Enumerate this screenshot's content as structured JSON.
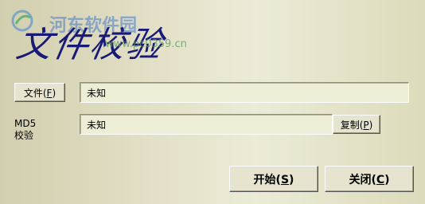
{
  "title_art": "文件校验",
  "watermark": {
    "site_name": "河东软件园",
    "url": "www.pc0359.cn"
  },
  "file_button": {
    "label_prefix": "文件(",
    "hotkey": "F",
    "label_suffix": ")"
  },
  "file_field": {
    "value": "未知"
  },
  "md5": {
    "label_line1": "MD5",
    "label_line2": "校验",
    "value": "未知"
  },
  "copy_button": {
    "label_prefix": "复制(",
    "hotkey": "P",
    "label_suffix": ")"
  },
  "start_button": {
    "label_prefix": "开始(",
    "hotkey": "S",
    "label_suffix": ")"
  },
  "close_button": {
    "label_prefix": "关闭(",
    "hotkey": "C",
    "label_suffix": ")"
  }
}
